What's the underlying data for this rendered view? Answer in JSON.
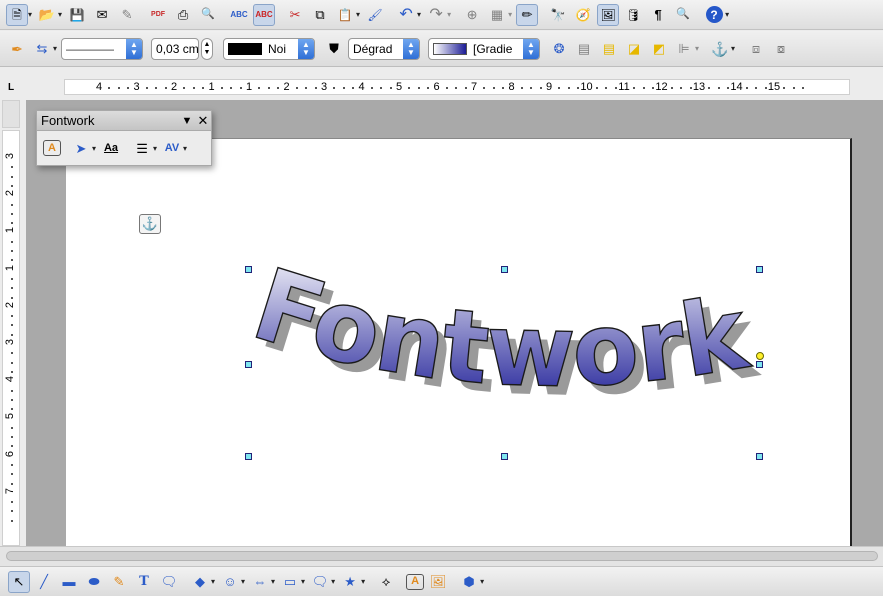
{
  "standard_toolbar": {
    "items": [
      {
        "name": "new-document",
        "icon": "document-stack-icon",
        "glyph": "🗎"
      },
      {
        "name": "open",
        "icon": "folder-open-icon",
        "glyph": "📂"
      },
      {
        "name": "save",
        "icon": "floppy-disk-icon",
        "glyph": "💾"
      },
      {
        "name": "email",
        "icon": "envelope-arrow-icon",
        "glyph": "✉"
      },
      {
        "name": "edit-file",
        "icon": "pencil-page-icon",
        "glyph": "✎"
      },
      {
        "name": "export-pdf",
        "icon": "pdf-icon",
        "glyph": "PDF"
      },
      {
        "name": "print",
        "icon": "printer-icon",
        "glyph": "⎙"
      },
      {
        "name": "print-preview",
        "icon": "magnifier-page-icon",
        "glyph": "🔍"
      },
      {
        "name": "spellcheck",
        "icon": "abc-check-icon",
        "glyph": "ABC"
      },
      {
        "name": "autospell",
        "icon": "abc-wave-icon",
        "glyph": "ABC"
      },
      {
        "name": "cut",
        "icon": "scissors-icon",
        "glyph": "✂"
      },
      {
        "name": "copy",
        "icon": "copy-icon",
        "glyph": "⧉"
      },
      {
        "name": "paste",
        "icon": "clipboard-icon",
        "glyph": "📋"
      },
      {
        "name": "clone-format",
        "icon": "paintbrush-icon",
        "glyph": "🖌"
      },
      {
        "name": "undo",
        "icon": "undo-icon",
        "glyph": "↶"
      },
      {
        "name": "redo",
        "icon": "redo-icon",
        "glyph": "↷"
      },
      {
        "name": "hyperlink",
        "icon": "globe-icon",
        "glyph": "⊕"
      },
      {
        "name": "table",
        "icon": "table-icon",
        "glyph": "▦"
      },
      {
        "name": "show-draw-functions",
        "icon": "draw-pencil-icon",
        "glyph": "✏"
      },
      {
        "name": "find-replace",
        "icon": "binoculars-icon",
        "glyph": "🔭"
      },
      {
        "name": "navigator",
        "icon": "compass-icon",
        "glyph": "🧭"
      },
      {
        "name": "gallery",
        "icon": "gallery-icon",
        "glyph": "🖼"
      },
      {
        "name": "data-sources",
        "icon": "database-icon",
        "glyph": "🛢"
      },
      {
        "name": "formatting-marks",
        "icon": "pilcrow-icon",
        "glyph": "¶"
      },
      {
        "name": "zoom",
        "icon": "magnifier-icon",
        "glyph": "🔍"
      },
      {
        "name": "help",
        "icon": "help-icon",
        "glyph": "?"
      }
    ]
  },
  "format_toolbar": {
    "line_style_value": "————",
    "line_width_value": "0,03 cm",
    "line_color_value": "Noi",
    "area_style_value": "Dégrad",
    "area_fill_value": "[Gradie"
  },
  "ruler": {
    "corner": "L",
    "labels": [
      "4",
      "3",
      "2",
      "1",
      "1",
      "2",
      "3",
      "4",
      "5",
      "6",
      "7",
      "8",
      "9",
      "10",
      "11",
      "12",
      "13",
      "14",
      "15"
    ],
    "vertical_labels": [
      "3",
      "2",
      "1",
      "1",
      "2",
      "3",
      "4",
      "5",
      "6",
      "7"
    ]
  },
  "fontwork_palette": {
    "title": "Fontwork",
    "tools": [
      {
        "name": "fontwork-gallery",
        "icon": "fontwork-gallery-icon",
        "glyph": "A"
      },
      {
        "name": "fontwork-shape",
        "icon": "fontwork-shape-icon",
        "glyph": "➤"
      },
      {
        "name": "fontwork-same-height",
        "icon": "same-letter-height-icon",
        "glyph": "Aa"
      },
      {
        "name": "fontwork-alignment",
        "icon": "align-icon",
        "glyph": "☰"
      },
      {
        "name": "fontwork-spacing",
        "icon": "character-spacing-icon",
        "glyph": "AV"
      }
    ]
  },
  "document": {
    "fontwork_text": "Fontwork",
    "gradient_start": "#ffffff",
    "gradient_end": "#1c1c96",
    "shadow_color": "#9a9a9a",
    "handle_color": "#00b7c7"
  },
  "drawing_toolbar": {
    "items": [
      {
        "name": "select",
        "icon": "pointer-icon",
        "glyph": "↖"
      },
      {
        "name": "line",
        "icon": "line-icon",
        "glyph": "╱"
      },
      {
        "name": "rectangle",
        "icon": "rectangle-icon",
        "glyph": "▬"
      },
      {
        "name": "ellipse",
        "icon": "ellipse-icon",
        "glyph": "⬭"
      },
      {
        "name": "freeform",
        "icon": "freeform-icon",
        "glyph": "✎"
      },
      {
        "name": "text",
        "icon": "text-icon",
        "glyph": "T"
      },
      {
        "name": "callouts",
        "icon": "callout-icon",
        "glyph": "💬"
      },
      {
        "name": "basic-shapes",
        "icon": "diamond-icon",
        "glyph": "◆"
      },
      {
        "name": "symbol-shapes",
        "icon": "smiley-icon",
        "glyph": "☺"
      },
      {
        "name": "block-arrows",
        "icon": "double-arrow-icon",
        "glyph": "⇔"
      },
      {
        "name": "flowchart",
        "icon": "flowchart-icon",
        "glyph": "▭"
      },
      {
        "name": "callout-shapes",
        "icon": "speech-bubble-icon",
        "glyph": "🗨"
      },
      {
        "name": "stars",
        "icon": "star-icon",
        "glyph": "★"
      },
      {
        "name": "points",
        "icon": "points-icon",
        "glyph": "⟡"
      },
      {
        "name": "fontwork-gallery",
        "icon": "fontwork-icon",
        "glyph": "A"
      },
      {
        "name": "from-file",
        "icon": "image-icon",
        "glyph": "🖼"
      },
      {
        "name": "extrusion",
        "icon": "extrusion-icon",
        "glyph": "⬢"
      }
    ]
  }
}
